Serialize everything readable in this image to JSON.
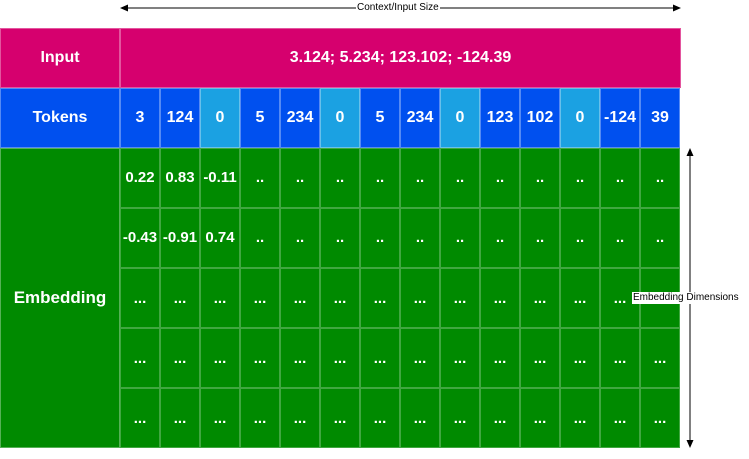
{
  "context_label": "Context/Input Size",
  "dimension_label": "Embedding Dimensions",
  "rows": {
    "input": "Input",
    "tokens": "Tokens",
    "embedding": "Embedding"
  },
  "input_value": "3.124; 5.234; 123.102; -124.39",
  "tokens": [
    {
      "text": "3",
      "separator": false
    },
    {
      "text": "124",
      "separator": false
    },
    {
      "text": "0",
      "separator": true
    },
    {
      "text": "5",
      "separator": false
    },
    {
      "text": "234",
      "separator": false
    },
    {
      "text": "0",
      "separator": true
    },
    {
      "text": "5",
      "separator": false
    },
    {
      "text": "234",
      "separator": false
    },
    {
      "text": "0",
      "separator": true
    },
    {
      "text": "123",
      "separator": false
    },
    {
      "text": "102",
      "separator": false
    },
    {
      "text": "0",
      "separator": true
    },
    {
      "text": "-124",
      "separator": false
    },
    {
      "text": "39",
      "separator": false
    }
  ],
  "embedding": [
    [
      "0.22",
      "0.83",
      "-0.11",
      "..",
      "..",
      "..",
      "..",
      "..",
      "..",
      "..",
      "..",
      "..",
      "..",
      ".."
    ],
    [
      "-0.43",
      "-0.91",
      "0.74",
      "..",
      "..",
      "..",
      "..",
      "..",
      "..",
      "..",
      "..",
      "..",
      "..",
      ".."
    ],
    [
      "...",
      "...",
      "...",
      "...",
      "...",
      "...",
      "...",
      "...",
      "...",
      "...",
      "...",
      "...",
      "...",
      "..."
    ],
    [
      "...",
      "...",
      "...",
      "...",
      "...",
      "...",
      "...",
      "...",
      "...",
      "...",
      "...",
      "...",
      "...",
      "..."
    ],
    [
      "...",
      "...",
      "...",
      "...",
      "...",
      "...",
      "...",
      "...",
      "...",
      "...",
      "...",
      "...",
      "...",
      "..."
    ]
  ],
  "colors": {
    "input": "#d6006e",
    "tokens": "#0050ef",
    "separator_token": "#1ba1e2",
    "embedding": "#008a00"
  }
}
